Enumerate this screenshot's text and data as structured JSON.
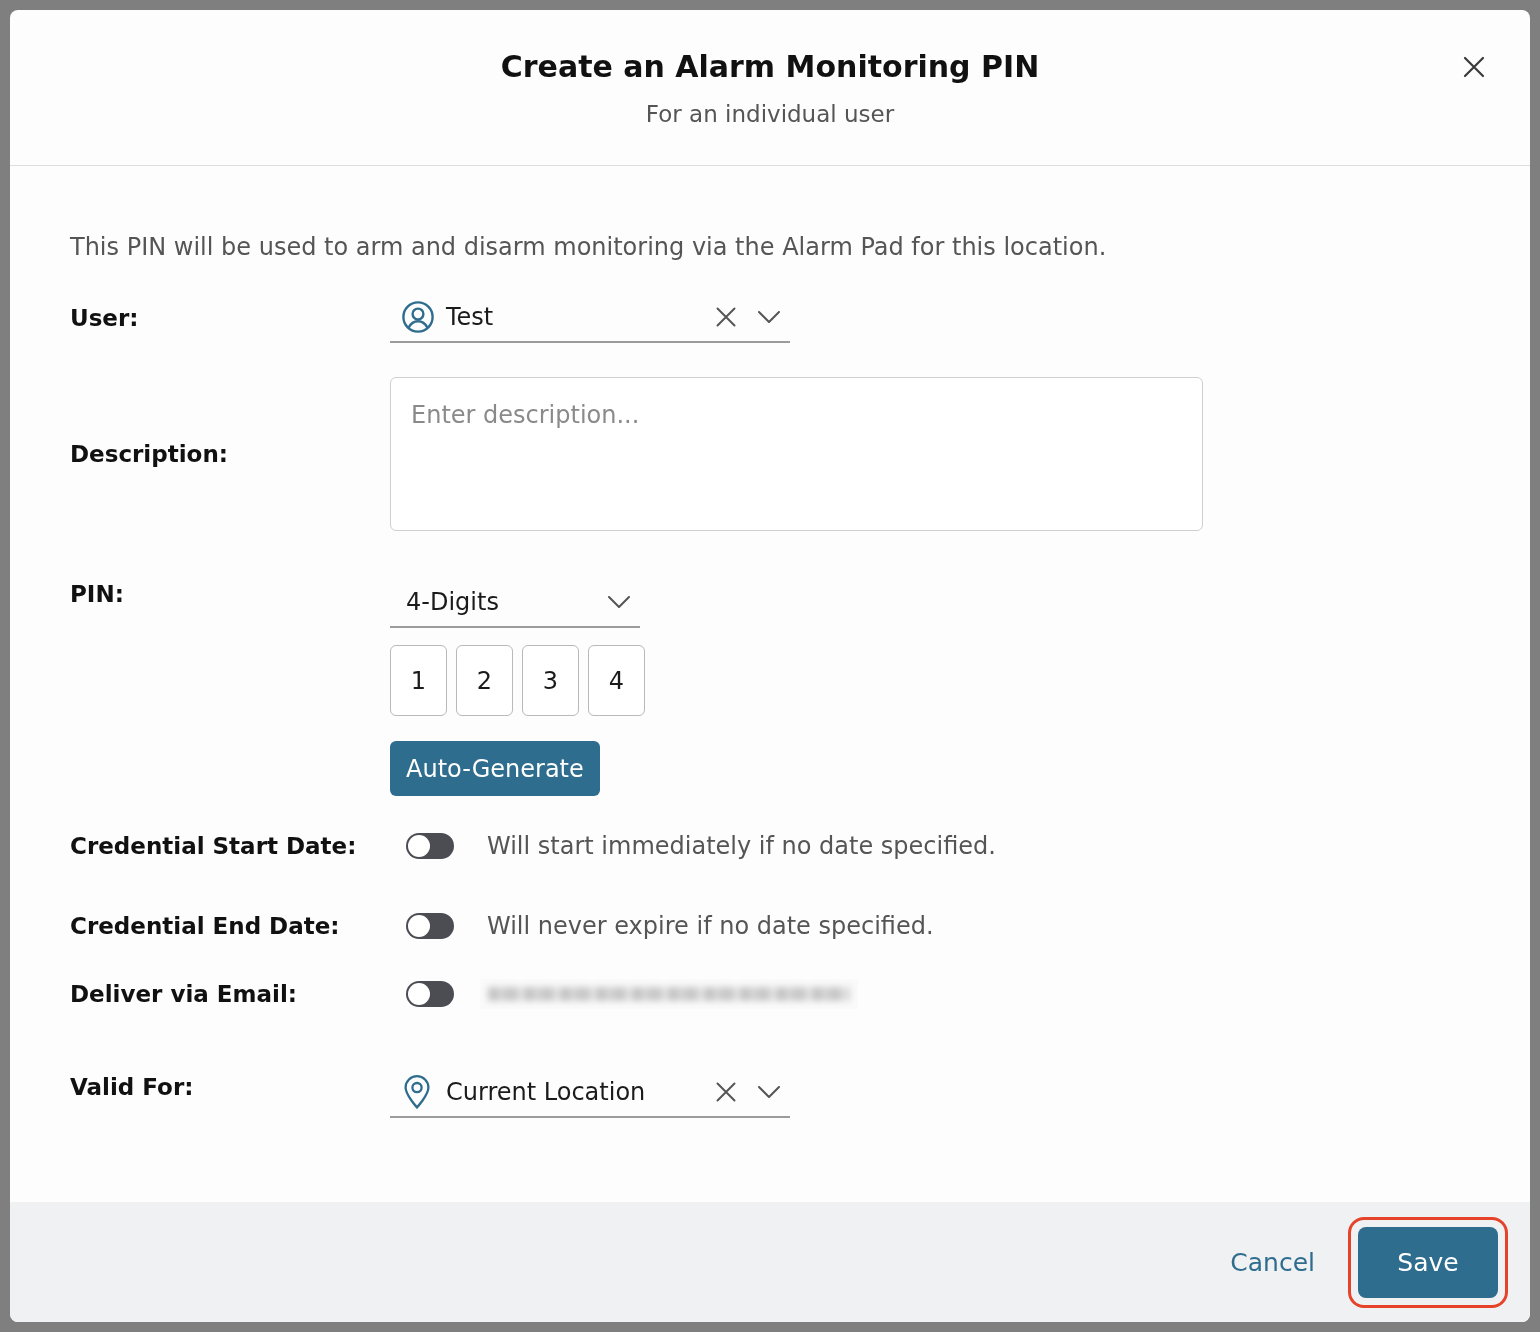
{
  "dialog": {
    "title": "Create an Alarm Monitoring PIN",
    "subtitle": "For an individual user"
  },
  "intro": "This PIN will be used to arm and disarm monitoring via the Alarm Pad for this location.",
  "user": {
    "label": "User:",
    "value": "Test"
  },
  "description": {
    "label": "Description:",
    "placeholder": "Enter description..."
  },
  "pin": {
    "label": "PIN:",
    "length": "4-Digits",
    "digits": [
      "1",
      "2",
      "3",
      "4"
    ],
    "generate_button": "Auto-Generate"
  },
  "start_date": {
    "label": "Credential Start Date:",
    "on": false,
    "hint": "Will start immediately if no date specified."
  },
  "end_date": {
    "label": "Credential End Date:",
    "on": false,
    "hint": "Will never expire if no date specified."
  },
  "email": {
    "label": "Deliver via Email:",
    "on": false,
    "redacted": true
  },
  "valid_for": {
    "label": "Valid For:",
    "value": "Current Location"
  },
  "footer": {
    "cancel": "Cancel",
    "save": "Save",
    "save_highlighted": true
  }
}
